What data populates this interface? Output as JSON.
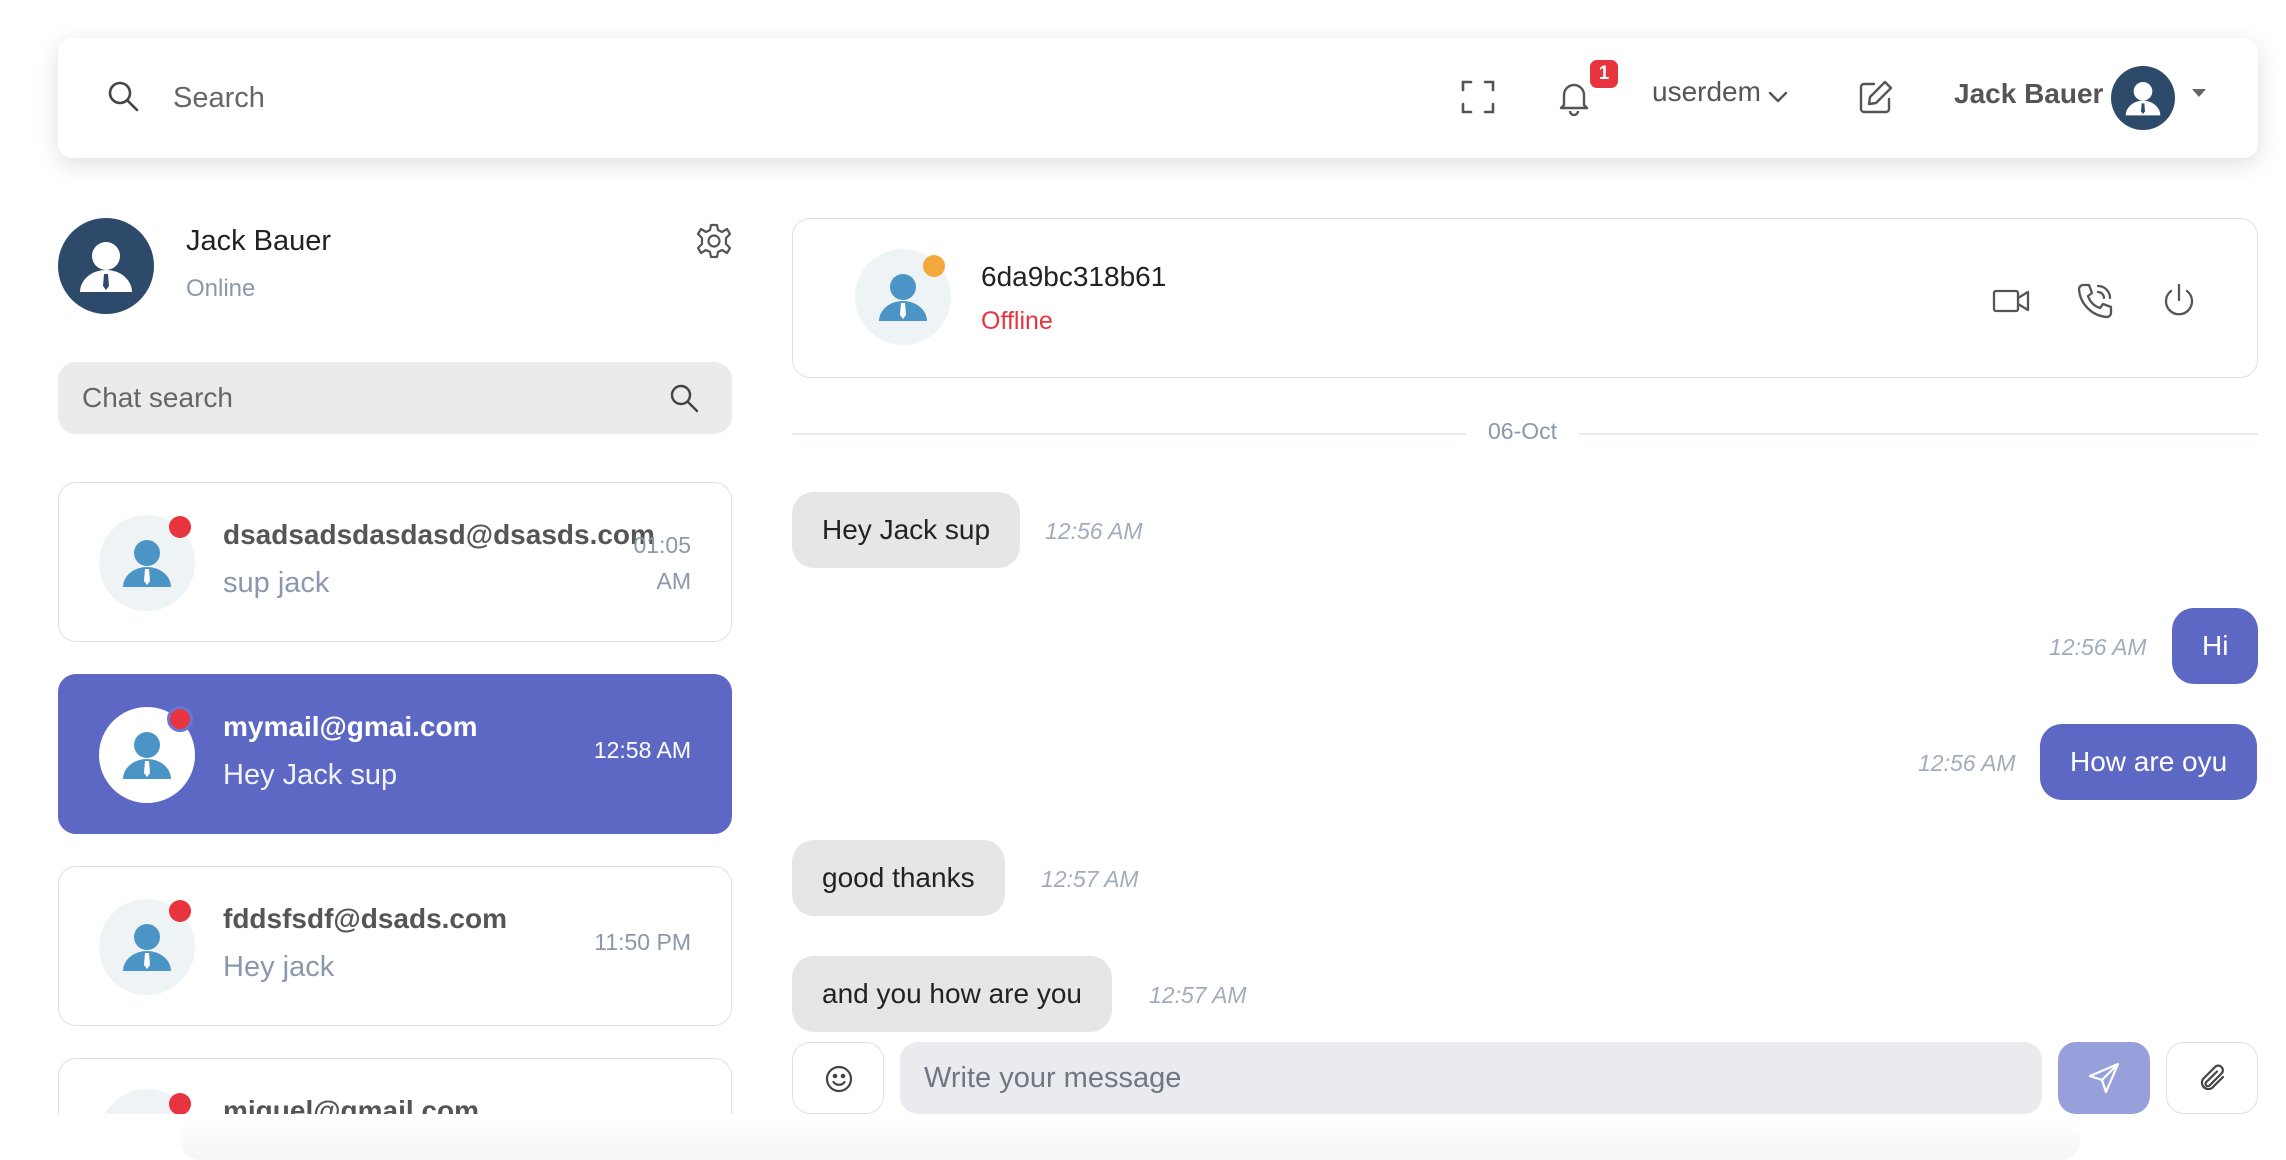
{
  "navbar": {
    "search_placeholder": "Search",
    "notification_count": "1",
    "username_menu": "userdem",
    "profile_name": "Jack Bauer",
    "icons": [
      "search-icon",
      "fullscreen-icon",
      "bell-icon",
      "chevron-down-icon",
      "edit-icon",
      "user-avatar",
      "caret-down-icon"
    ]
  },
  "sidebar": {
    "me": {
      "name": "Jack Bauer",
      "status": "Online"
    },
    "search_placeholder": "Chat search",
    "contacts": [
      {
        "name": "dsadsadsdasdasd@dsasds.com",
        "last_message": "sup jack",
        "time_line1": "01:05",
        "time_line2": "AM",
        "active": false
      },
      {
        "name": "mymail@gmai.com",
        "last_message": "Hey Jack sup",
        "time": "12:58 AM",
        "active": true
      },
      {
        "name": "fddsfsdf@dsads.com",
        "last_message": "Hey jack",
        "time": "11:50 PM",
        "active": false
      },
      {
        "name": "miguel@gmail.com",
        "last_message": "",
        "time": "",
        "active": false
      }
    ]
  },
  "chat": {
    "peer": {
      "name": "6da9bc318b61",
      "status": "Offline"
    },
    "header_icons": [
      "video-call-icon",
      "phone-call-icon",
      "power-icon"
    ],
    "date_divider": "06-Oct",
    "messages": [
      {
        "direction": "in",
        "text": "Hey Jack sup",
        "time": "12:56 AM"
      },
      {
        "direction": "out",
        "text": "Hi",
        "time": "12:56 AM"
      },
      {
        "direction": "out",
        "text": "How are oyu",
        "time": "12:56 AM"
      },
      {
        "direction": "in",
        "text": "good thanks",
        "time": "12:57 AM"
      },
      {
        "direction": "in",
        "text": "and you how are you",
        "time": "12:57 AM"
      }
    ],
    "composer_placeholder": "Write your message"
  },
  "colors": {
    "accent": "#5d68c4",
    "send_button": "#98a0dc",
    "offline_red": "#e8343f",
    "away_orange": "#f2a83b",
    "avatar_navy": "#2e4a6b",
    "avatar_blue": "#4b94c6"
  }
}
